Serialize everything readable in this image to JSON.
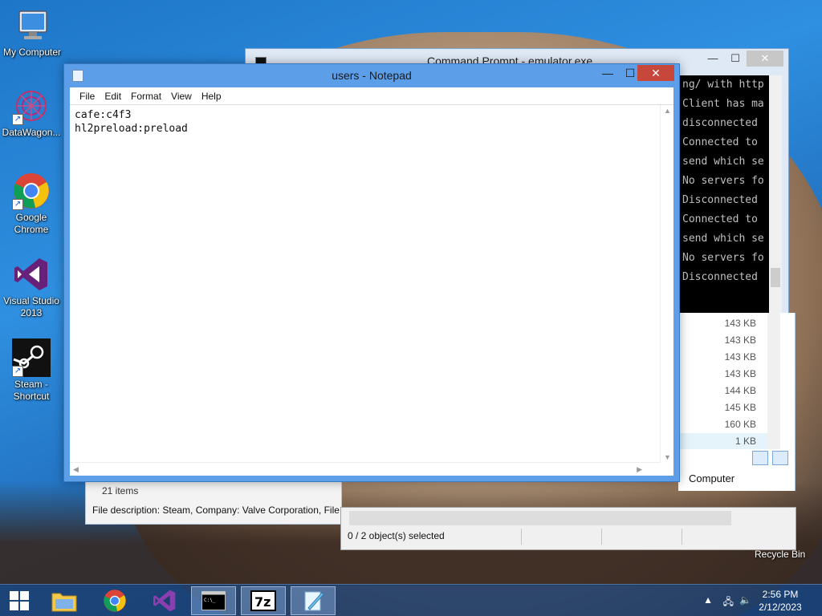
{
  "desktop": {
    "icons": [
      {
        "label": "My Computer"
      },
      {
        "label": "DataWagon..."
      },
      {
        "label": "Google Chrome"
      },
      {
        "label": "Visual Studio 2013"
      },
      {
        "label": "Steam - Shortcut"
      }
    ],
    "recycle_bin": "Recycle Bin"
  },
  "cmd": {
    "title": "Command Prompt - emulator.exe",
    "lines": [
      "ng/ with http",
      "Client has ma",
      "disconnected",
      "Connected to",
      "send which se",
      "No servers fo",
      "Disconnected",
      "Connected to",
      "send which se",
      "No servers fo",
      "Disconnected"
    ]
  },
  "explorer": {
    "sizes": [
      "143 KB",
      "143 KB",
      "143 KB",
      "143 KB",
      "144 KB",
      "145 KB",
      "160 KB",
      "1 KB"
    ],
    "item_count": "21 items",
    "file_description": "File description: Steam, Company: Valve Corporation, File v",
    "computer_label": "Computer"
  },
  "sevenzip": {
    "selection": "0 / 2 object(s) selected"
  },
  "notepad": {
    "title": "users - Notepad",
    "menu": [
      "File",
      "Edit",
      "Format",
      "View",
      "Help"
    ],
    "content": "cafe:c4f3\nhl2preload:preload"
  },
  "taskbar": {
    "time": "2:56 PM",
    "date": "2/12/2023",
    "apps": [
      "start",
      "file-explorer",
      "chrome",
      "visual-studio",
      "command-prompt",
      "7-zip",
      "notepad"
    ]
  }
}
